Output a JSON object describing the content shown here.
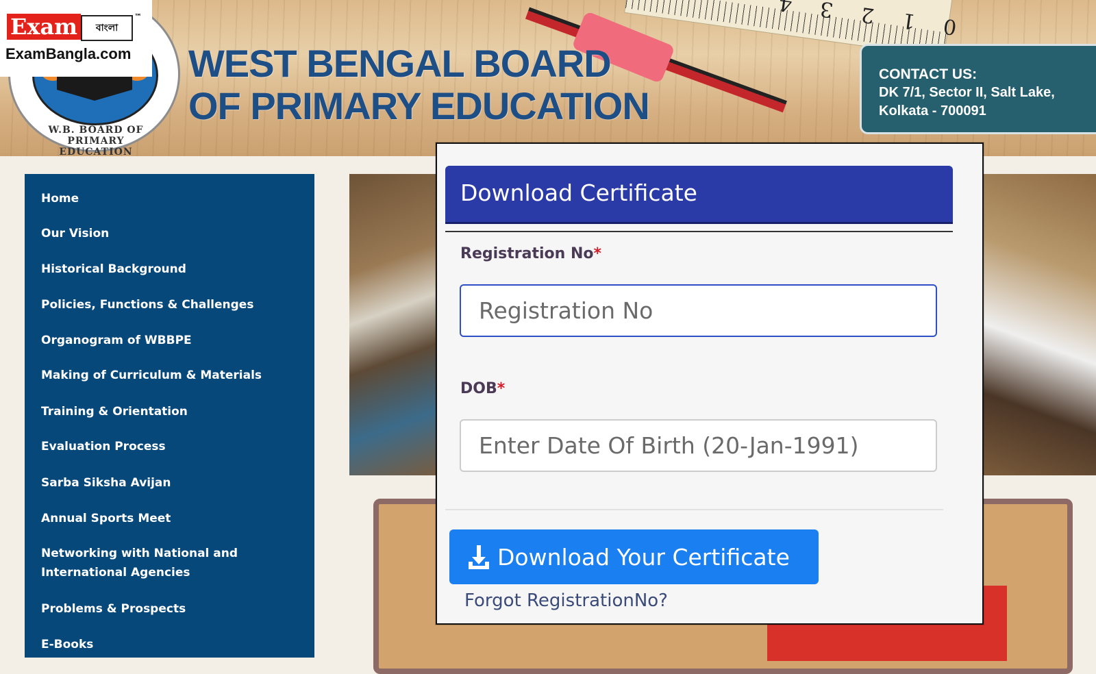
{
  "brand": {
    "logo_text": "Exam",
    "logo_bangla": "বাংলা",
    "tm": "™",
    "url": "ExamBangla.com"
  },
  "header": {
    "title_line1": "WEST BENGAL BOARD",
    "title_line2": "OF PRIMARY EDUCATION",
    "seal_text": "W.B. BOARD OF PRIMARY EDUCATION",
    "ruler_numbers": "0 1 2 3 4",
    "contact_title": "CONTACT US:",
    "contact_line1": "DK 7/1, Sector II, Salt Lake,",
    "contact_line2": "Kolkata - 700091"
  },
  "sidebar": {
    "items": [
      {
        "label": "Home"
      },
      {
        "label": "Our Vision"
      },
      {
        "label": "Historical Background"
      },
      {
        "label": "Policies, Functions & Challenges"
      },
      {
        "label": "Organogram of WBBPE"
      },
      {
        "label": "Making of Curriculum & Materials"
      },
      {
        "label": "Training & Orientation"
      },
      {
        "label": "Evaluation Process"
      },
      {
        "label": "Sarba Siksha Avijan"
      },
      {
        "label": "Annual Sports Meet"
      },
      {
        "label": "Networking with National and"
      },
      {
        "label": "International Agencies"
      },
      {
        "label": "Problems & Prospects"
      },
      {
        "label": "E-Books"
      }
    ]
  },
  "modal": {
    "title": "Download Certificate",
    "reg_label": "Registration No",
    "reg_placeholder": "Registration No",
    "dob_label": "DOB",
    "dob_placeholder": "Enter Date Of Birth (20-Jan-1991)",
    "required_mark": "*",
    "download_button": "Download Your Certificate",
    "forgot_link": "Forgot RegistrationNo?"
  },
  "colors": {
    "sidebar_bg": "#07487a",
    "modal_header": "#2a3aa6",
    "button": "#1a7ff0",
    "title_blue": "#1d4e86",
    "contact_bg": "#26606f",
    "required_red": "#d21d2a"
  },
  "icons": [
    "download-icon"
  ]
}
